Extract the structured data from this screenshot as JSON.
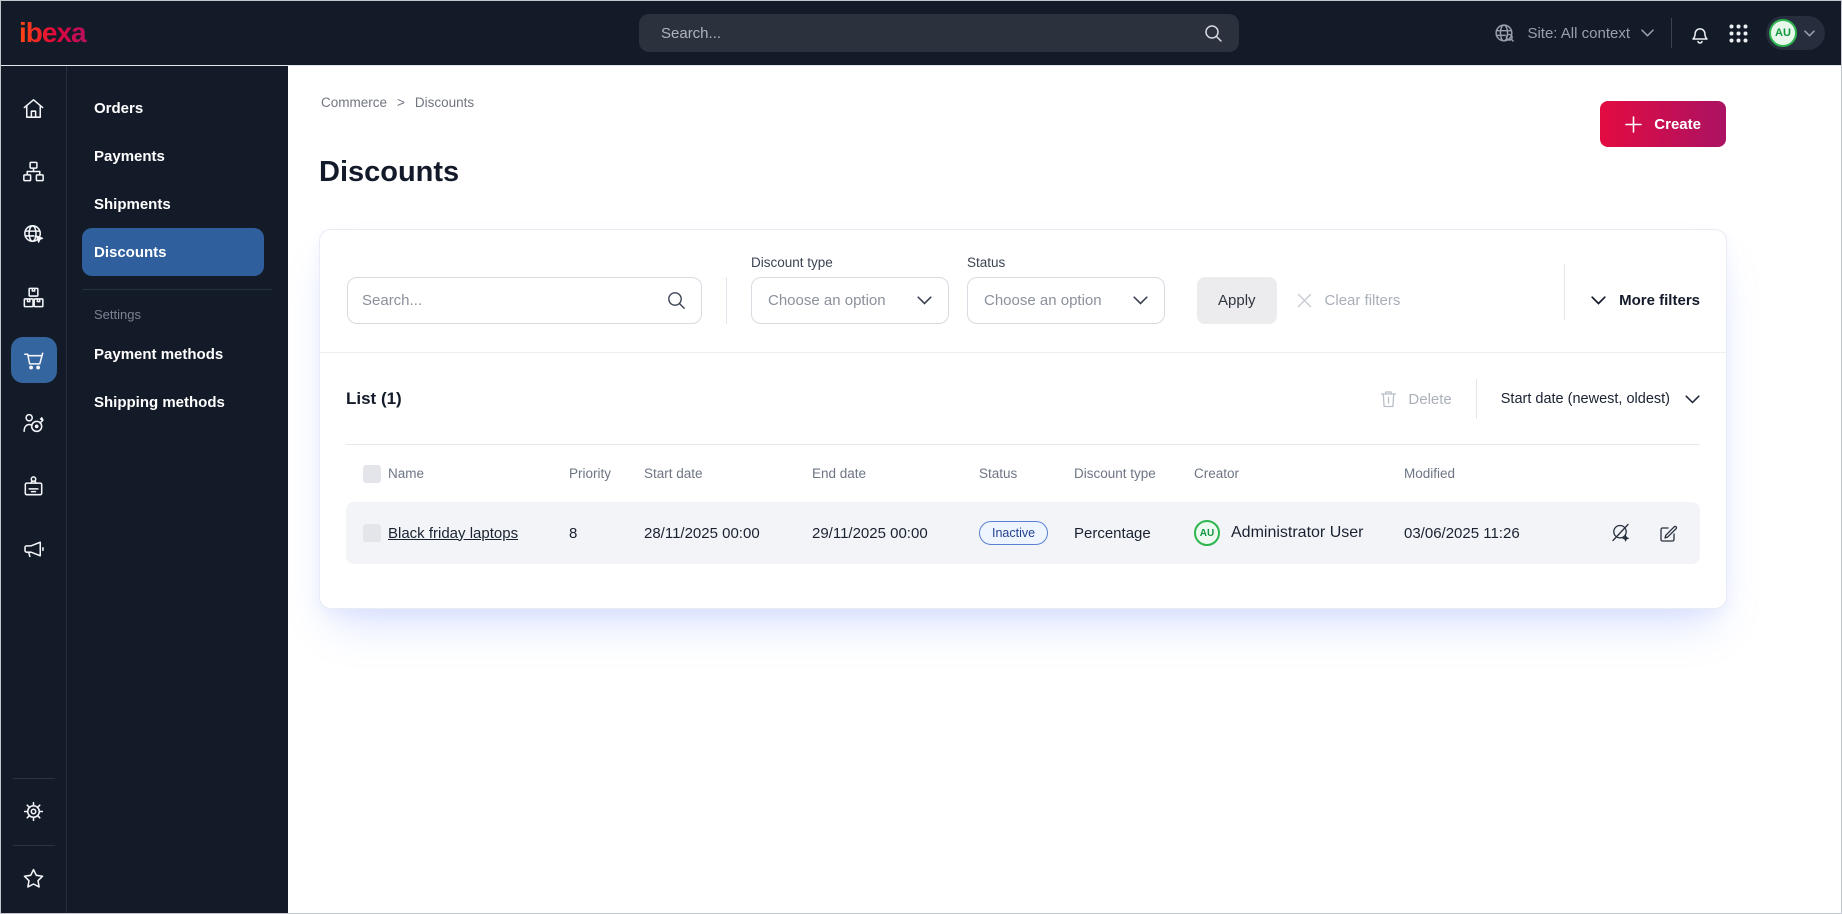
{
  "topbar": {
    "logo_text": "ibexa",
    "search_placeholder": "Search...",
    "site_context": "Site: All context",
    "avatar_initials": "AU"
  },
  "rail_icons": [
    "home-icon",
    "content-tree-icon",
    "site-globe-icon",
    "product-boxes-icon",
    "commerce-cart-icon",
    "customer-target-icon",
    "member-badge-icon",
    "marketing-megaphone-icon",
    "settings-gear-icon",
    "bookmark-star-icon"
  ],
  "menu": {
    "items": [
      {
        "label": "Orders"
      },
      {
        "label": "Payments"
      },
      {
        "label": "Shipments"
      },
      {
        "label": "Discounts",
        "active": true
      }
    ],
    "settings_label": "Settings",
    "settings_items": [
      {
        "label": "Payment methods"
      },
      {
        "label": "Shipping methods"
      }
    ]
  },
  "page": {
    "breadcrumb": [
      "Commerce",
      "Discounts"
    ],
    "breadcrumb_sep": ">",
    "title": "Discounts",
    "create_label": "Create"
  },
  "filters": {
    "search_placeholder": "Search...",
    "discount_type_label": "Discount type",
    "discount_type_value": "Choose an option",
    "status_label": "Status",
    "status_value": "Choose an option",
    "apply_label": "Apply",
    "clear_label": "Clear filters",
    "more_label": "More filters"
  },
  "list": {
    "title": "List (1)",
    "delete_label": "Delete",
    "sort_label": "Start date (newest, oldest)",
    "columns": [
      "Name",
      "Priority",
      "Start date",
      "End date",
      "Status",
      "Discount type",
      "Creator",
      "Modified"
    ],
    "rows": [
      {
        "name": "Black friday laptops",
        "priority": "8",
        "start_date": "28/11/2025 00:00",
        "end_date": "29/11/2025 00:00",
        "status": "Inactive",
        "discount_type": "Percentage",
        "creator_initials": "AU",
        "creator": "Administrator User",
        "modified": "03/06/2025 11:26"
      }
    ]
  },
  "colors": {
    "topbar_bg": "#131a28",
    "active_blue": "#2f5f9c",
    "accent_gradient_start": "#e30b41",
    "accent_gradient_end": "#ab1263",
    "badge_border": "#5b80d6",
    "badge_text": "#24418f",
    "avatar_green": "#2db54f"
  }
}
